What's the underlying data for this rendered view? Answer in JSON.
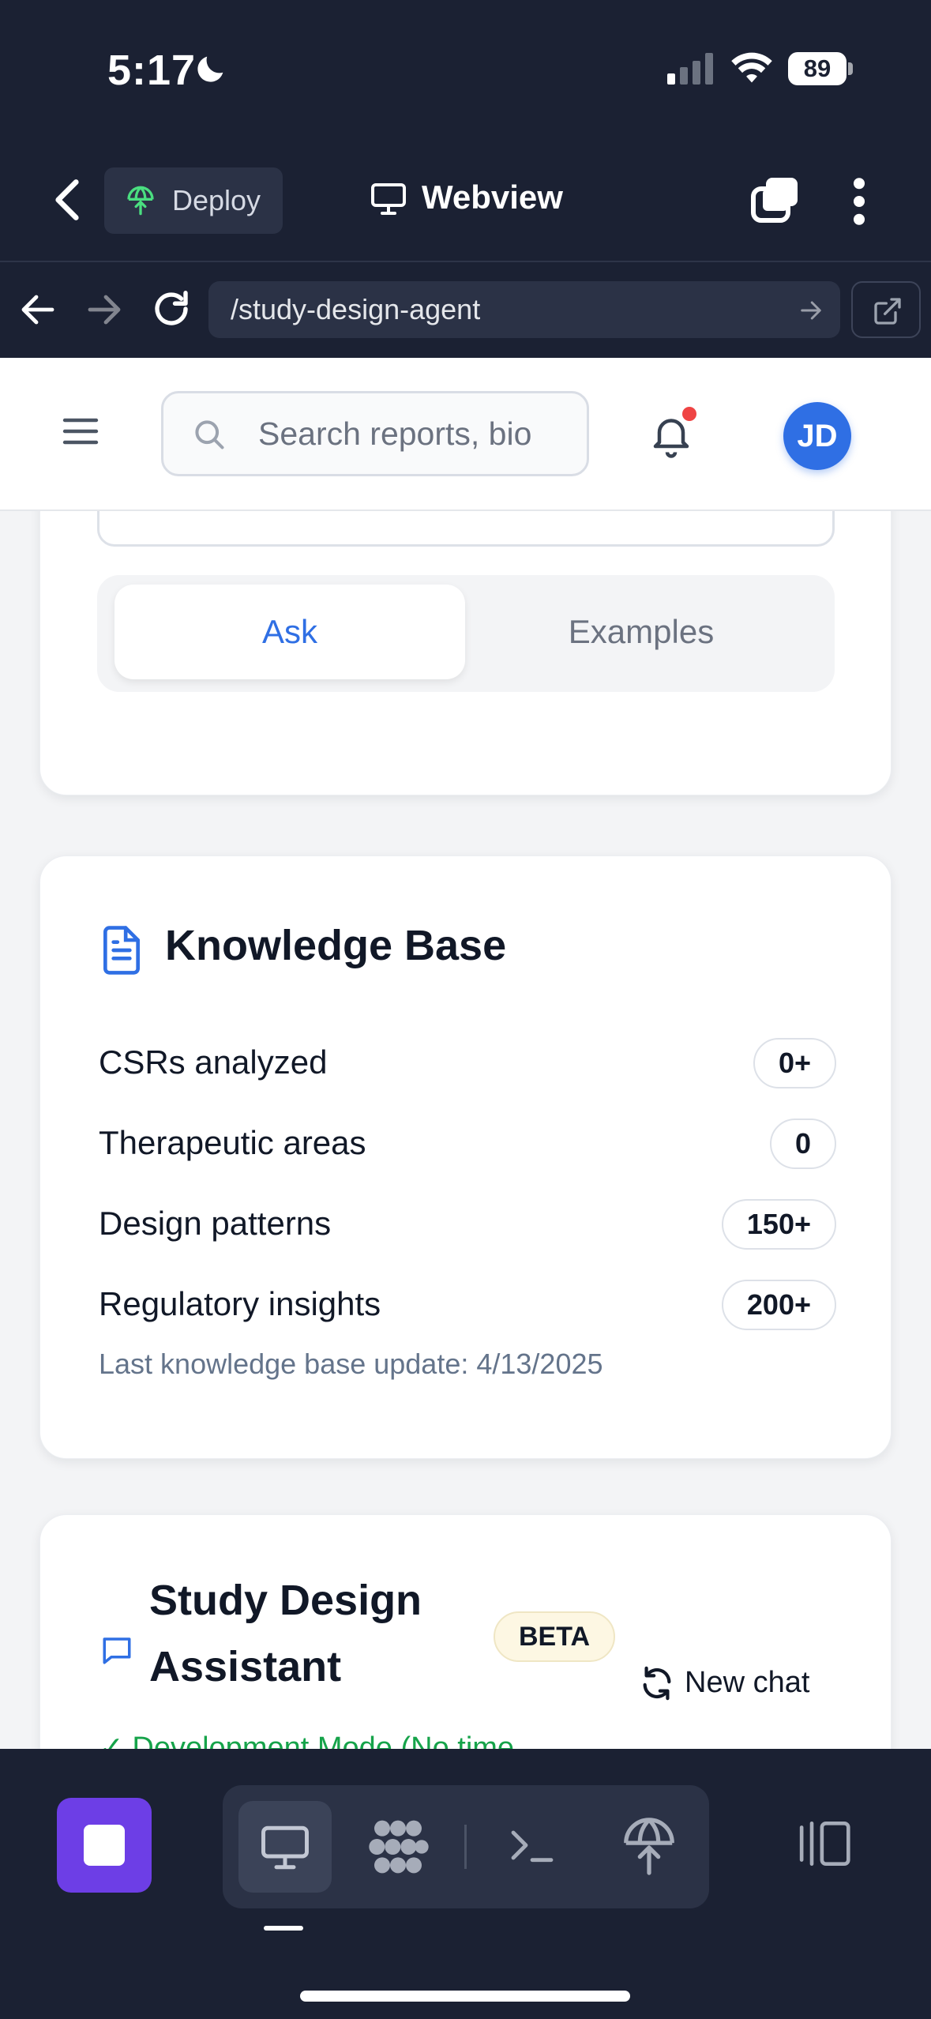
{
  "status_bar": {
    "time": "5:17",
    "battery": "89"
  },
  "app_bar": {
    "deploy_label": "Deploy",
    "view_label": "Webview"
  },
  "browser": {
    "url": "/study-design-agent"
  },
  "header": {
    "search_placeholder": "Search reports, bio",
    "avatar_initials": "JD",
    "accent_color": "#2f6fe4",
    "notification_dot_color": "#ef4444"
  },
  "query_card": {
    "tabs": [
      {
        "label": "Ask",
        "active": true
      },
      {
        "label": "Examples",
        "active": false
      }
    ]
  },
  "knowledge_base": {
    "title": "Knowledge Base",
    "rows": [
      {
        "label": "CSRs analyzed",
        "value": "0+"
      },
      {
        "label": "Therapeutic areas",
        "value": "0"
      },
      {
        "label": "Design patterns",
        "value": "150+"
      },
      {
        "label": "Regulatory insights",
        "value": "200+"
      }
    ],
    "last_update": "Last knowledge base update: 4/13/2025"
  },
  "assistant": {
    "title": "Study Design Assistant",
    "badge": "BETA",
    "new_chat_label": "New chat",
    "mode_text": "✓ Development Mode (No time"
  },
  "toolbar": {
    "stop_color": "#6d3ee6",
    "icons": [
      "stop-icon",
      "monitor-icon",
      "agents-icon",
      "terminal-icon",
      "deploy-icon",
      "layout-icon"
    ]
  }
}
